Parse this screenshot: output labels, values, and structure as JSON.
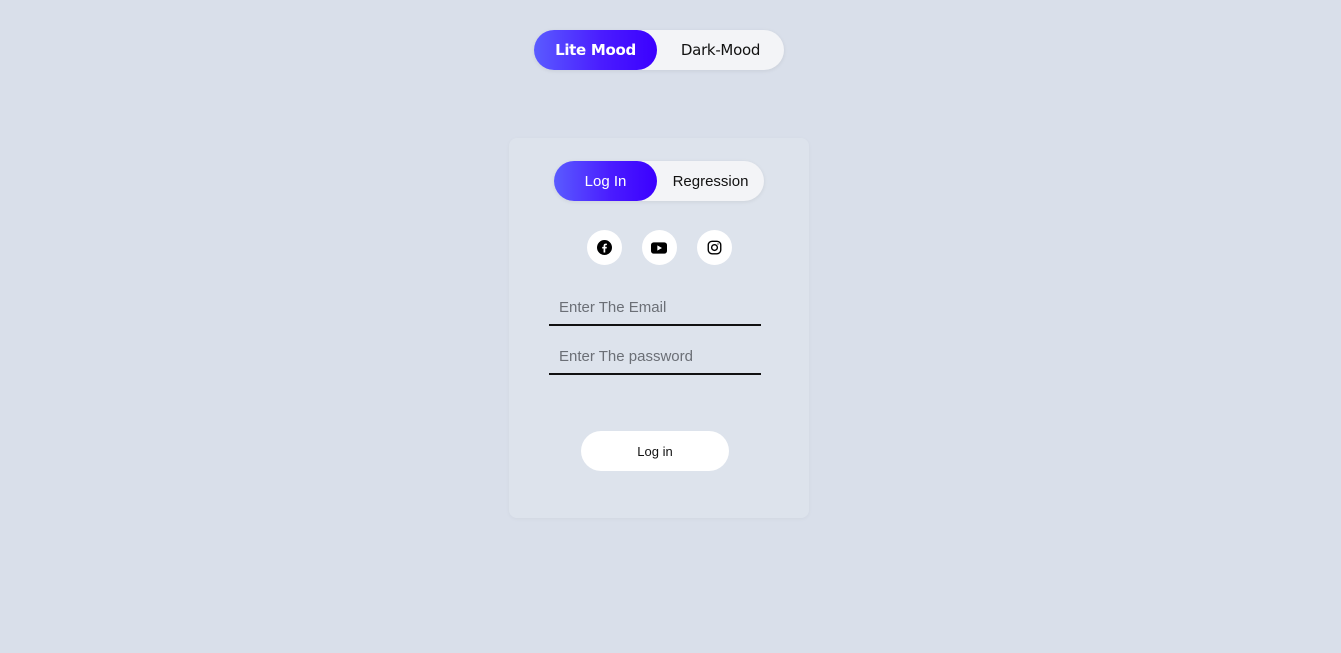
{
  "theme_toggle": {
    "active_label": "Lite Mood",
    "inactive_label": "Dark-Mood"
  },
  "auth_tabs": {
    "active_label": "Log In",
    "inactive_label": "Regression"
  },
  "socials": [
    {
      "icon": "facebook-icon"
    },
    {
      "icon": "youtube-icon"
    },
    {
      "icon": "instagram-icon"
    }
  ],
  "form": {
    "email_placeholder": "Enter The Email",
    "password_placeholder": "Enter The password",
    "submit_label": "Log in"
  },
  "colors": {
    "background": "#d9dfea",
    "card": "#dde3ec",
    "accent_start": "#5a5bff",
    "accent_end": "#3b00ff"
  }
}
